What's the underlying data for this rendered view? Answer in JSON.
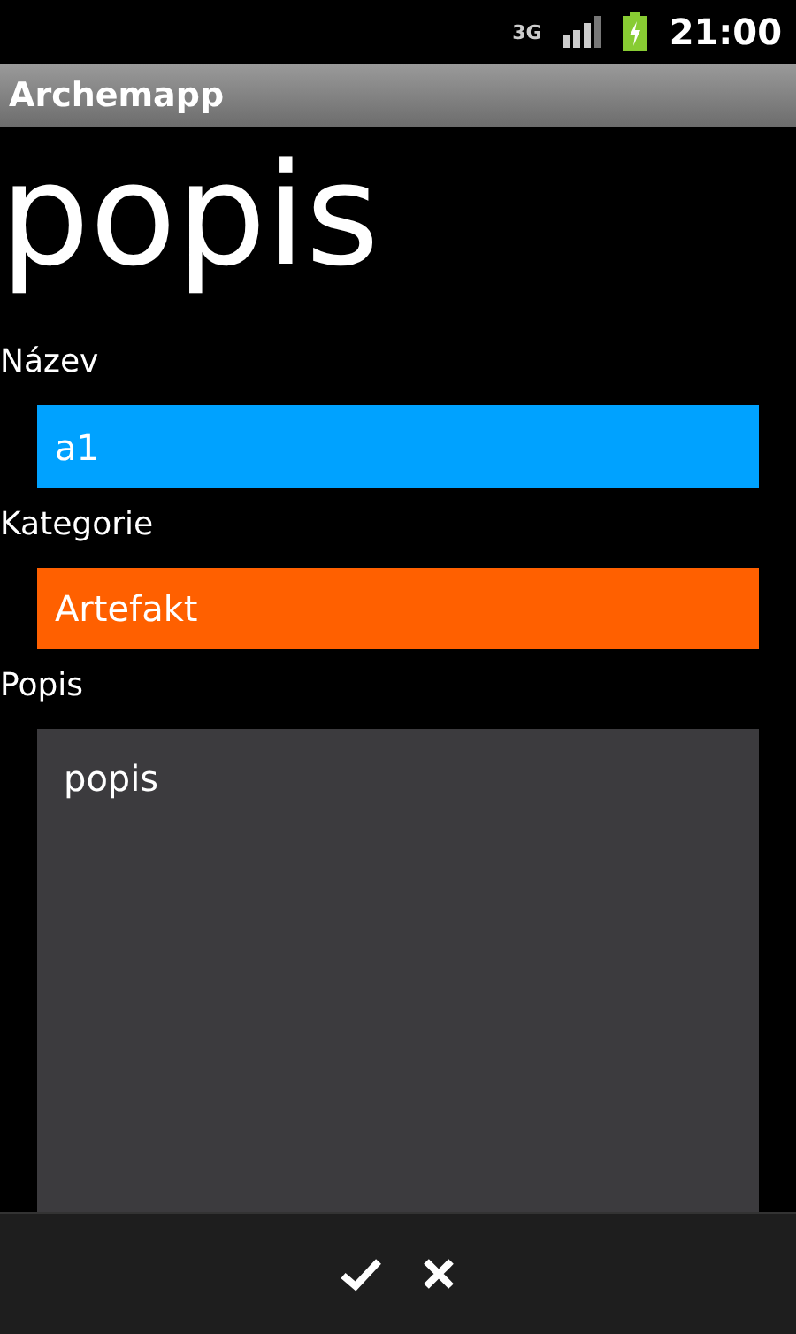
{
  "status_bar": {
    "network": "3G",
    "time": "21:00"
  },
  "window": {
    "title": "Archemapp"
  },
  "heading": "popis",
  "fields": [
    {
      "kind": "text",
      "label": "Název",
      "value": "a1",
      "color": "#00a2ff"
    },
    {
      "kind": "select",
      "label": "Kategorie",
      "value": "Artefakt",
      "color": "#ff6000"
    },
    {
      "kind": "textarea",
      "label": "Popis",
      "value": "popis",
      "color": "#3c3b3e"
    }
  ],
  "actions": [
    {
      "kind": "confirm"
    },
    {
      "kind": "cancel"
    }
  ]
}
